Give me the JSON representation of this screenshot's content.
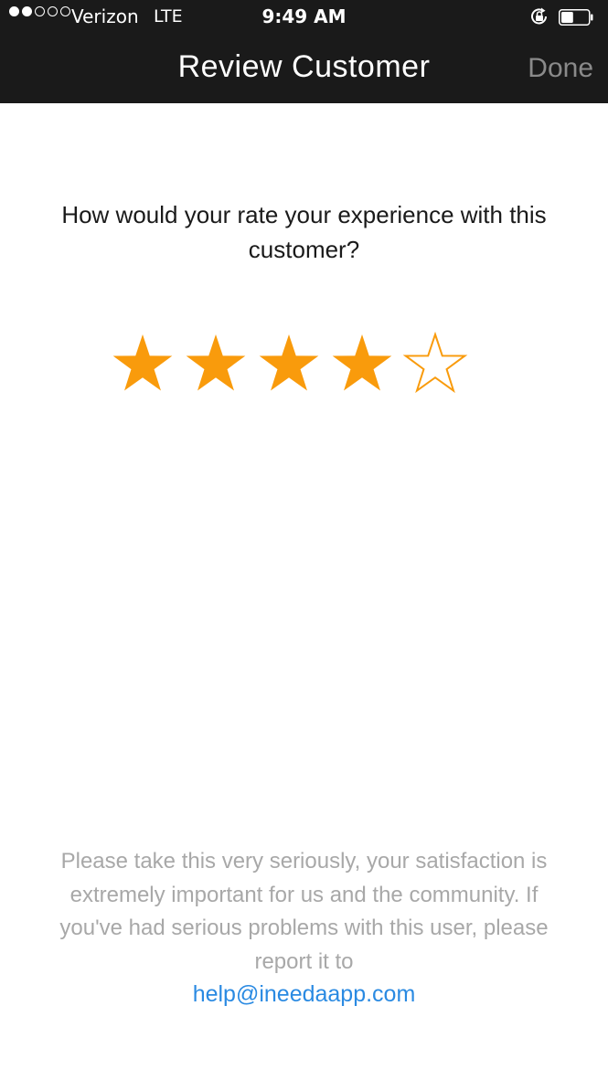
{
  "status_bar": {
    "carrier": "Verizon",
    "network": "LTE",
    "time": "9:49 AM",
    "signal_bars_filled": 2,
    "signal_bars_total": 5,
    "battery_level": 0.45,
    "orientation_lock_icon": "orientation-lock-icon",
    "battery_icon": "battery-icon"
  },
  "nav": {
    "title": "Review Customer",
    "done_label": "Done"
  },
  "review": {
    "question": "How would your rate your experience with this customer?",
    "rating": 4,
    "max_rating": 5,
    "star_color": "#f99b0c"
  },
  "footer": {
    "note": "Please take this very seriously, your satisfaction is extremely important for us and the community. If you've had serious problems with this user, please report it to",
    "email": "help@ineedaapp.com",
    "link_color": "#2a8ae2"
  }
}
